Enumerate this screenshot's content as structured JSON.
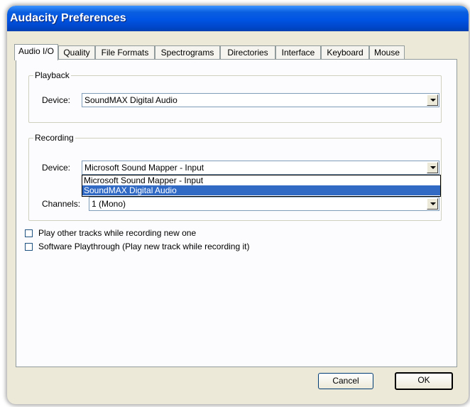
{
  "window": {
    "title": "Audacity Preferences"
  },
  "tabs": [
    {
      "label": "Audio I/O",
      "active": true
    },
    {
      "label": "Quality"
    },
    {
      "label": "File Formats"
    },
    {
      "label": "Spectrograms"
    },
    {
      "label": "Directories"
    },
    {
      "label": "Interface"
    },
    {
      "label": "Keyboard"
    },
    {
      "label": "Mouse"
    }
  ],
  "playback": {
    "group_label": "Playback",
    "device_label": "Device:",
    "device_value": "SoundMAX Digital Audio"
  },
  "recording": {
    "group_label": "Recording",
    "device_label": "Device:",
    "device_value": "Microsoft Sound Mapper - Input",
    "device_options": [
      "Microsoft Sound Mapper - Input",
      "SoundMAX Digital Audio"
    ],
    "highlighted_option": "SoundMAX Digital Audio",
    "channels_label": "Channels:",
    "channels_value": "1 (Mono)"
  },
  "options": {
    "play_other_tracks": {
      "label": "Play other tracks while recording new one",
      "checked": false
    },
    "software_playthrough": {
      "label": "Software Playthrough (Play new track while recording it)",
      "checked": false
    }
  },
  "buttons": {
    "cancel": "Cancel",
    "ok": "OK"
  }
}
